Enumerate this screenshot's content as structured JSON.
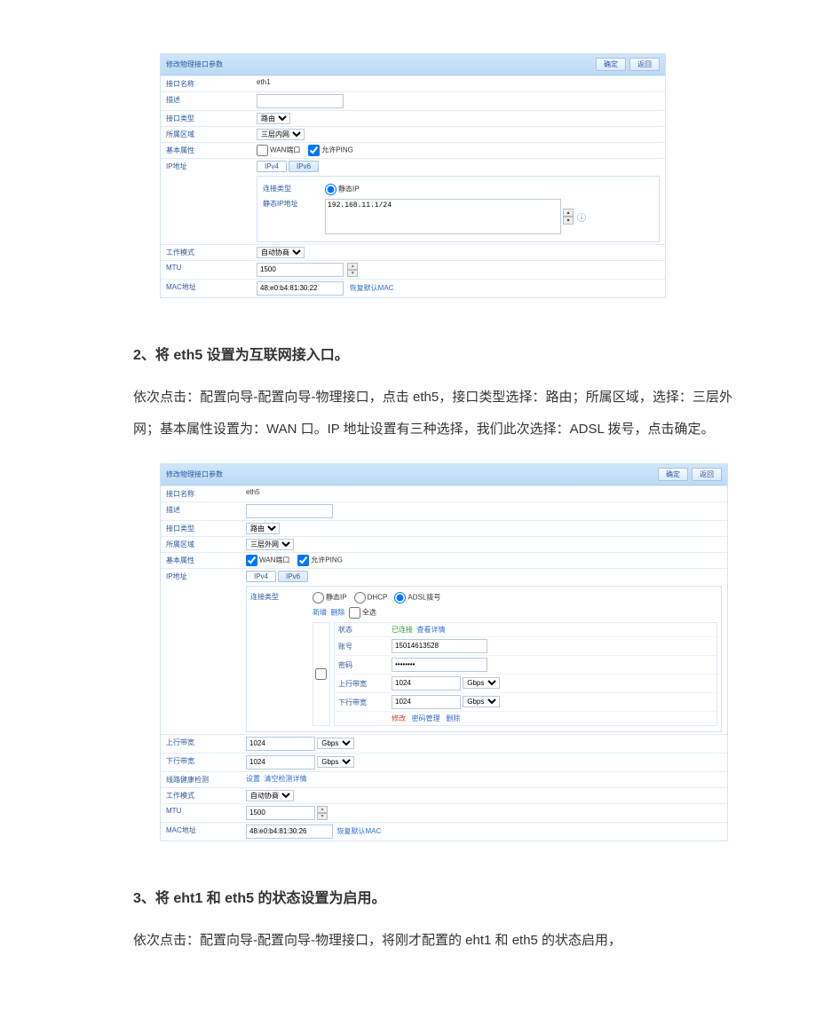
{
  "fig1": {
    "title": "修改物理接口参数",
    "btn_ok": "确定",
    "btn_back": "返回",
    "rows": {
      "name_lab": "接口名称",
      "name_val": "eth1",
      "desc_lab": "描述",
      "type_lab": "接口类型",
      "type_val": "路由",
      "zone_lab": "所属区域",
      "zone_val": "三层内网",
      "attr_lab": "基本属性",
      "wan_label": "WAN端口",
      "ping_label": "允许PING",
      "ip_lab": "IP地址",
      "tab_ipv4": "IPv4",
      "tab_ipv6": "IPv6",
      "conn_lab": "连接类型",
      "conn_static": "静态IP",
      "static_lab": "静态IP地址",
      "static_val": "192.168.11.1/24",
      "mode_lab": "工作模式",
      "mode_val": "自动协商",
      "mtu_lab": "MTU",
      "mtu_val": "1500",
      "mac_lab": "MAC地址",
      "mac_val": "48:e0:b4:81:30:22",
      "mac_reset": "恢复默认MAC"
    }
  },
  "text": {
    "h2_2": "2、将 eth5 设置为互联网接入口。",
    "p2": "依次点击：配置向导-配置向导-物理接口，点击 eth5，接口类型选择：路由；所属区域，选择：三层外网；基本属性设置为：WAN 口。IP 地址设置有三种选择，我们此次选择：ADSL 拨号，点击确定。",
    "h2_3": "3、将 eht1 和 eth5 的状态设置为启用。",
    "p3": "依次点击：配置向导-配置向导-物理接口，将刚才配置的 eht1 和 eth5 的状态启用，"
  },
  "fig2": {
    "title": "修改物理接口参数",
    "btn_ok": "确定",
    "btn_back": "返回",
    "rows": {
      "name_lab": "接口名称",
      "name_val": "eth5",
      "desc_lab": "描述",
      "type_lab": "接口类型",
      "type_val": "路由",
      "zone_lab": "所属区域",
      "zone_val": "三层外网",
      "attr_lab": "基本属性",
      "wan_label": "WAN端口",
      "ping_label": "允许PING",
      "ip_lab": "IP地址",
      "tab_ipv4": "IPv4",
      "tab_ipv6": "IPv6",
      "conn_lab": "连接类型",
      "conn_static": "静态IP",
      "conn_dhcp": "DHCP",
      "conn_adsl": "ADSL拨号",
      "ops_new": "新增",
      "ops_del": "删除",
      "ops_all": "全选",
      "col_ck": "☐",
      "adsl_status_lab": "状态",
      "adsl_status_val": "已连接",
      "adsl_status_link": "查看详情",
      "adsl_acct_lab": "账号",
      "adsl_acct_val": "15014613528",
      "adsl_pwd_lab": "密码",
      "adsl_pwd_val": "••••••••",
      "adsl_up_lab": "上行带宽",
      "adsl_up_val": "1024",
      "adsl_up_unit": "Gbps",
      "adsl_down_lab": "下行带宽",
      "adsl_down_val": "1024",
      "adsl_down_unit": "Gbps",
      "adsl_act_fix": "修改",
      "adsl_act_pass": "密码管理",
      "adsl_act_del": "删除",
      "up_lab": "上行带宽",
      "up_val": "1024",
      "up_unit": "Gbps",
      "down_lab": "下行带宽",
      "down_val": "1024",
      "down_unit": "Gbps",
      "health_lab": "线路健康检测",
      "health_set": "设置",
      "health_clear": "清空检测详情",
      "mode_lab": "工作模式",
      "mode_val": "自动协商",
      "mtu_lab": "MTU",
      "mtu_val": "1500",
      "mac_lab": "MAC地址",
      "mac_val": "48:e0:b4:81:30:26",
      "mac_reset": "恢复默认MAC"
    }
  }
}
